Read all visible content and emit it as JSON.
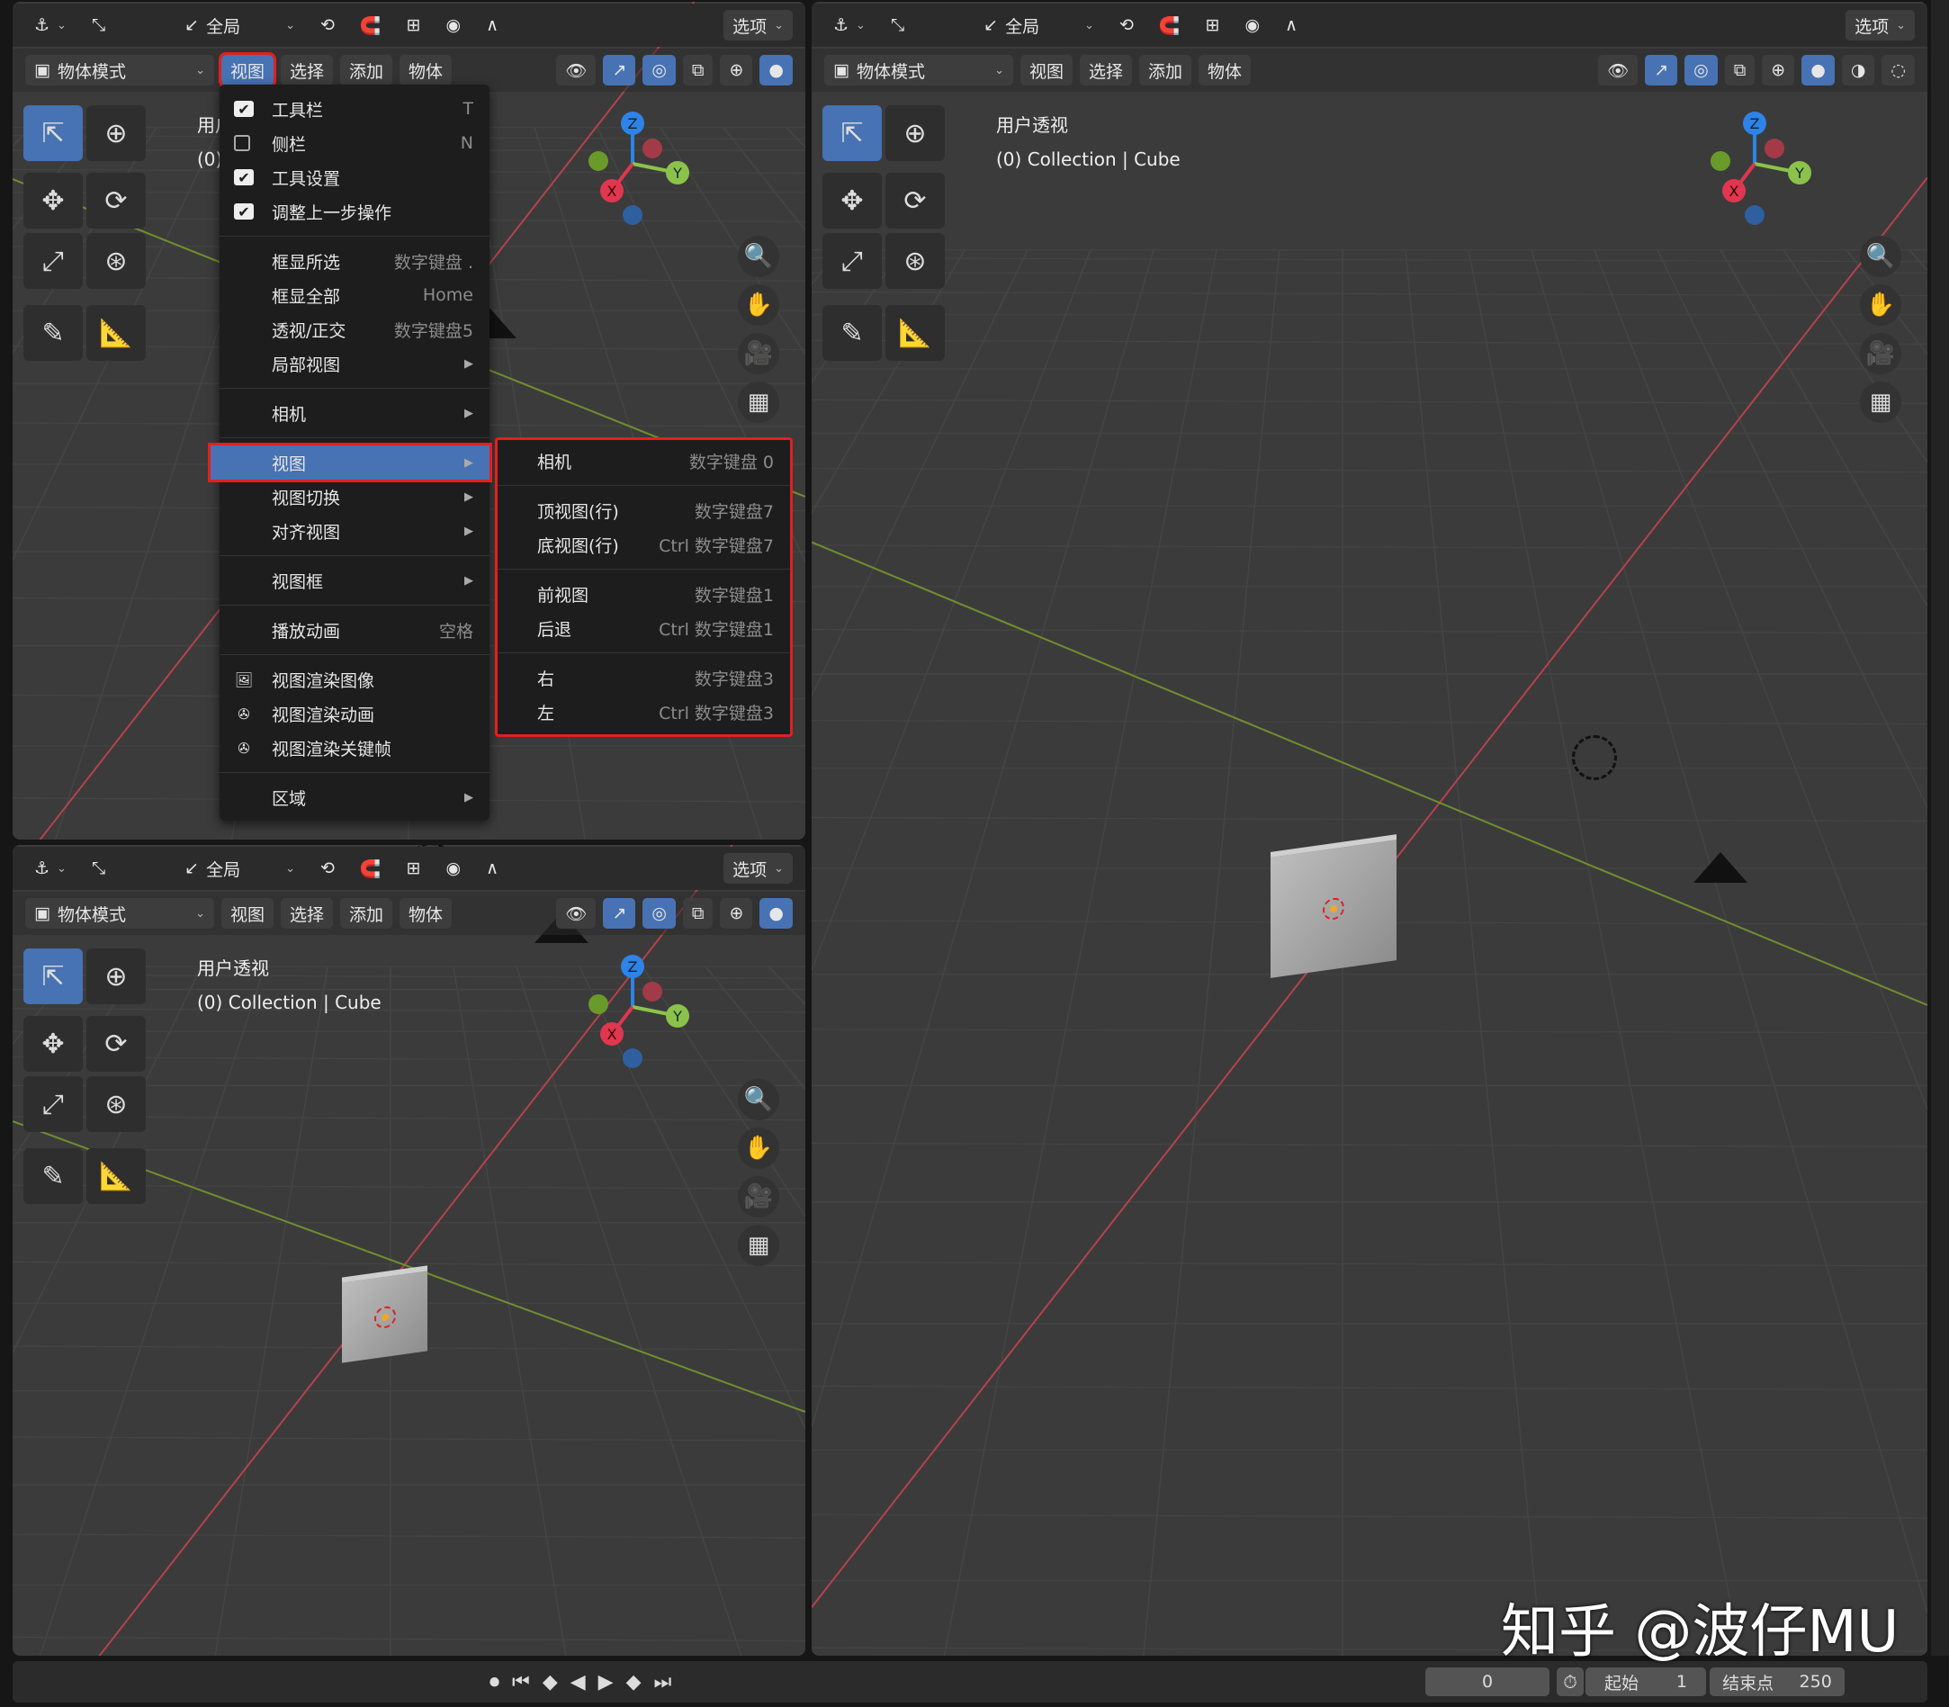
{
  "header_row1": {
    "orientation": "全局",
    "options": "选项"
  },
  "header_row2": {
    "mode": "物体模式",
    "menus": [
      "视图",
      "选择",
      "添加",
      "物体"
    ]
  },
  "viewport_info": {
    "view_name": "用户透视",
    "collection": "(0) Collection | Cube"
  },
  "gizmo": {
    "x": "X",
    "y": "Y",
    "z": "Z"
  },
  "view_menu": {
    "groups": [
      [
        {
          "label": "工具栏",
          "shortcut": "T",
          "check": true
        },
        {
          "label": "侧栏",
          "shortcut": "N",
          "check": false
        },
        {
          "label": "工具设置",
          "shortcut": "",
          "check": true
        },
        {
          "label": "调整上一步操作",
          "shortcut": "",
          "check": true
        }
      ],
      [
        {
          "label": "框显所选",
          "shortcut": "数字键盘 ."
        },
        {
          "label": "框显全部",
          "shortcut": "Home"
        },
        {
          "label": "透视/正交",
          "shortcut": "数字键盘5"
        },
        {
          "label": "局部视图",
          "submenu": true
        }
      ],
      [
        {
          "label": "相机",
          "submenu": true
        }
      ],
      [
        {
          "label": "视图",
          "submenu": true,
          "highlighted": true
        },
        {
          "label": "视图切换",
          "submenu": true
        },
        {
          "label": "对齐视图",
          "submenu": true
        }
      ],
      [
        {
          "label": "视图框",
          "submenu": true
        }
      ],
      [
        {
          "label": "播放动画",
          "shortcut": "空格"
        }
      ],
      [
        {
          "label": "视图渲染图像",
          "icon": "render-image-icon"
        },
        {
          "label": "视图渲染动画",
          "icon": "render-animation-icon"
        },
        {
          "label": "视图渲染关键帧",
          "icon": "render-animation-icon"
        }
      ],
      [
        {
          "label": "区域",
          "submenu": true
        }
      ]
    ]
  },
  "view_submenu": {
    "groups": [
      [
        {
          "label": "相机",
          "shortcut": "数字键盘 0"
        }
      ],
      [
        {
          "label": "顶视图(行)",
          "shortcut": "数字键盘7"
        },
        {
          "label": "底视图(行)",
          "shortcut": "Ctrl 数字键盘7"
        }
      ],
      [
        {
          "label": "前视图",
          "shortcut": "数字键盘1"
        },
        {
          "label": "后退",
          "shortcut": "Ctrl 数字键盘1"
        }
      ],
      [
        {
          "label": "右",
          "shortcut": "数字键盘3"
        },
        {
          "label": "左",
          "shortcut": "Ctrl 数字键盘3"
        }
      ]
    ]
  },
  "timeline": {
    "current_frame": "0",
    "start_label": "起始",
    "start": "1",
    "end_label": "结束点",
    "end": "250"
  },
  "watermark": "知乎 @波仔MU",
  "colors": {
    "accent": "#4772b3",
    "highlight_border": "#e02020",
    "x_axis": "#e0364f",
    "y_axis": "#8bc34a",
    "z_axis": "#2f83e6"
  }
}
